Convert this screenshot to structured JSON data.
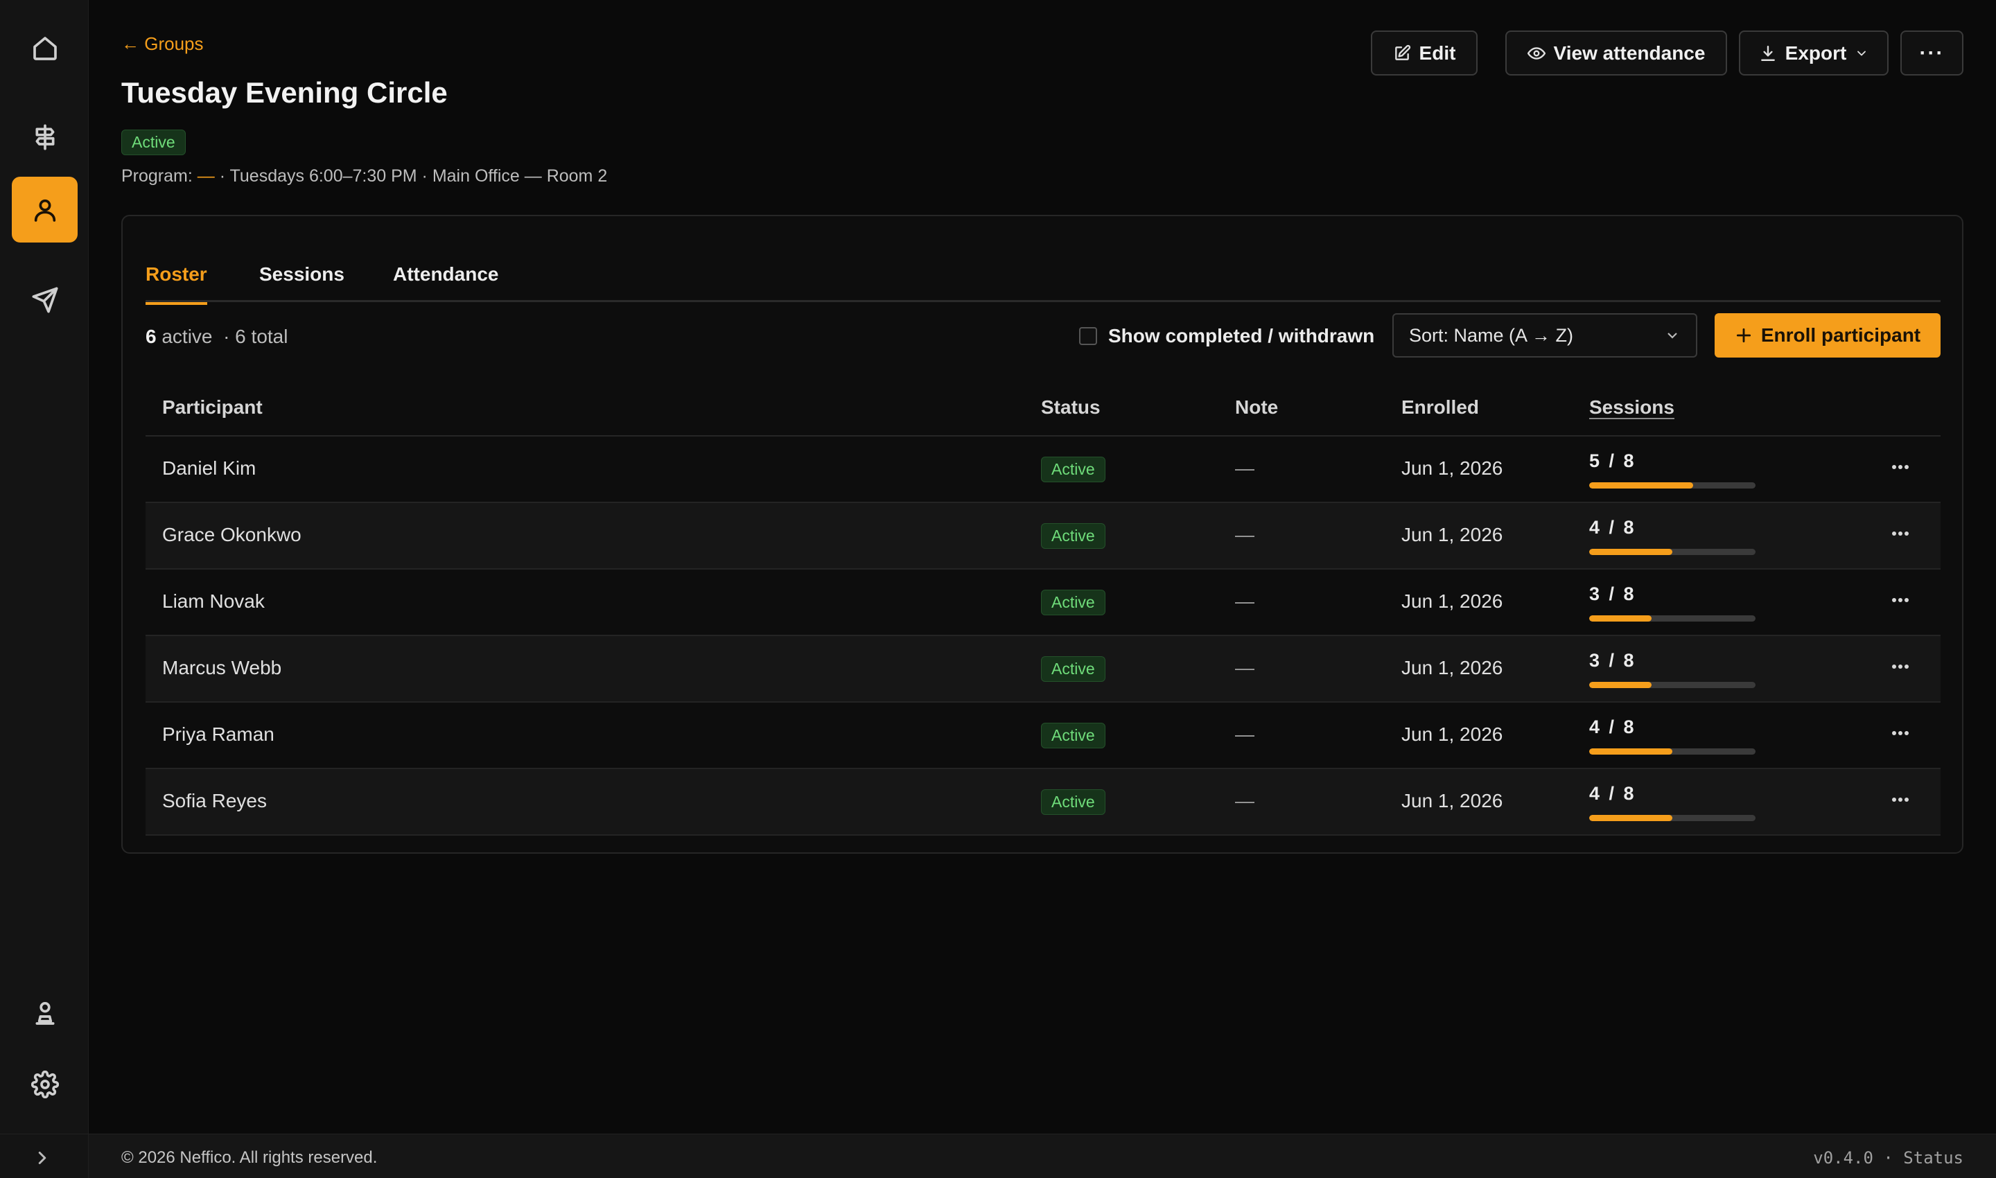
{
  "nav": {
    "home_icon": "home-icon",
    "signpost_icon": "signpost-icon",
    "people_icon": "user-icon",
    "send_icon": "send-icon",
    "profile_icon": "user-stamp-icon",
    "settings_icon": "gear-icon",
    "expand_icon": "chevron-right-icon"
  },
  "header": {
    "back_label": "← Groups",
    "title": "Tuesday Evening Circle",
    "status": "Active",
    "meta_prefix": "Program:",
    "meta_program": "—",
    "meta_rest": "· Tuesdays 6:00–7:30 PM · Main Office — Room 2"
  },
  "actions": {
    "edit": "Edit",
    "view_attendance": "View attendance",
    "export": "Export"
  },
  "tabs": [
    {
      "label": "Roster"
    },
    {
      "label": "Sessions"
    },
    {
      "label": "Attendance"
    }
  ],
  "roster": {
    "active_count": "6",
    "active_label": "active",
    "total_label": "· 6 total",
    "show_completed_label": "Show completed / withdrawn",
    "sort_label": "Sort: Name (A → Z)",
    "enroll_label": "Enroll participant"
  },
  "table": {
    "columns": [
      "Participant",
      "Status",
      "Note",
      "Enrolled",
      "Sessions"
    ],
    "rows": [
      {
        "name": "Daniel Kim",
        "status": "Active",
        "note": "—",
        "enrolled": "Jun 1, 2026",
        "sessions": "5 / 8",
        "progress": 0.625
      },
      {
        "name": "Grace Okonkwo",
        "status": "Active",
        "note": "—",
        "enrolled": "Jun 1, 2026",
        "sessions": "4 / 8",
        "progress": 0.5
      },
      {
        "name": "Liam Novak",
        "status": "Active",
        "note": "—",
        "enrolled": "Jun 1, 2026",
        "sessions": "3 / 8",
        "progress": 0.375
      },
      {
        "name": "Marcus Webb",
        "status": "Active",
        "note": "—",
        "enrolled": "Jun 1, 2026",
        "sessions": "3 / 8",
        "progress": 0.375
      },
      {
        "name": "Priya Raman",
        "status": "Active",
        "note": "—",
        "enrolled": "Jun 1, 2026",
        "sessions": "4 / 8",
        "progress": 0.5
      },
      {
        "name": "Sofia Reyes",
        "status": "Active",
        "note": "—",
        "enrolled": "Jun 1, 2026",
        "sessions": "4 / 8",
        "progress": 0.5
      }
    ]
  },
  "footer": {
    "copyright": "© 2026 Neffico. All rights reserved.",
    "version": "v0.4.0 · Status"
  },
  "colors": {
    "accent": "#f59e1b",
    "active_badge_text": "#6fdc7a",
    "background": "#0a0a0a"
  }
}
